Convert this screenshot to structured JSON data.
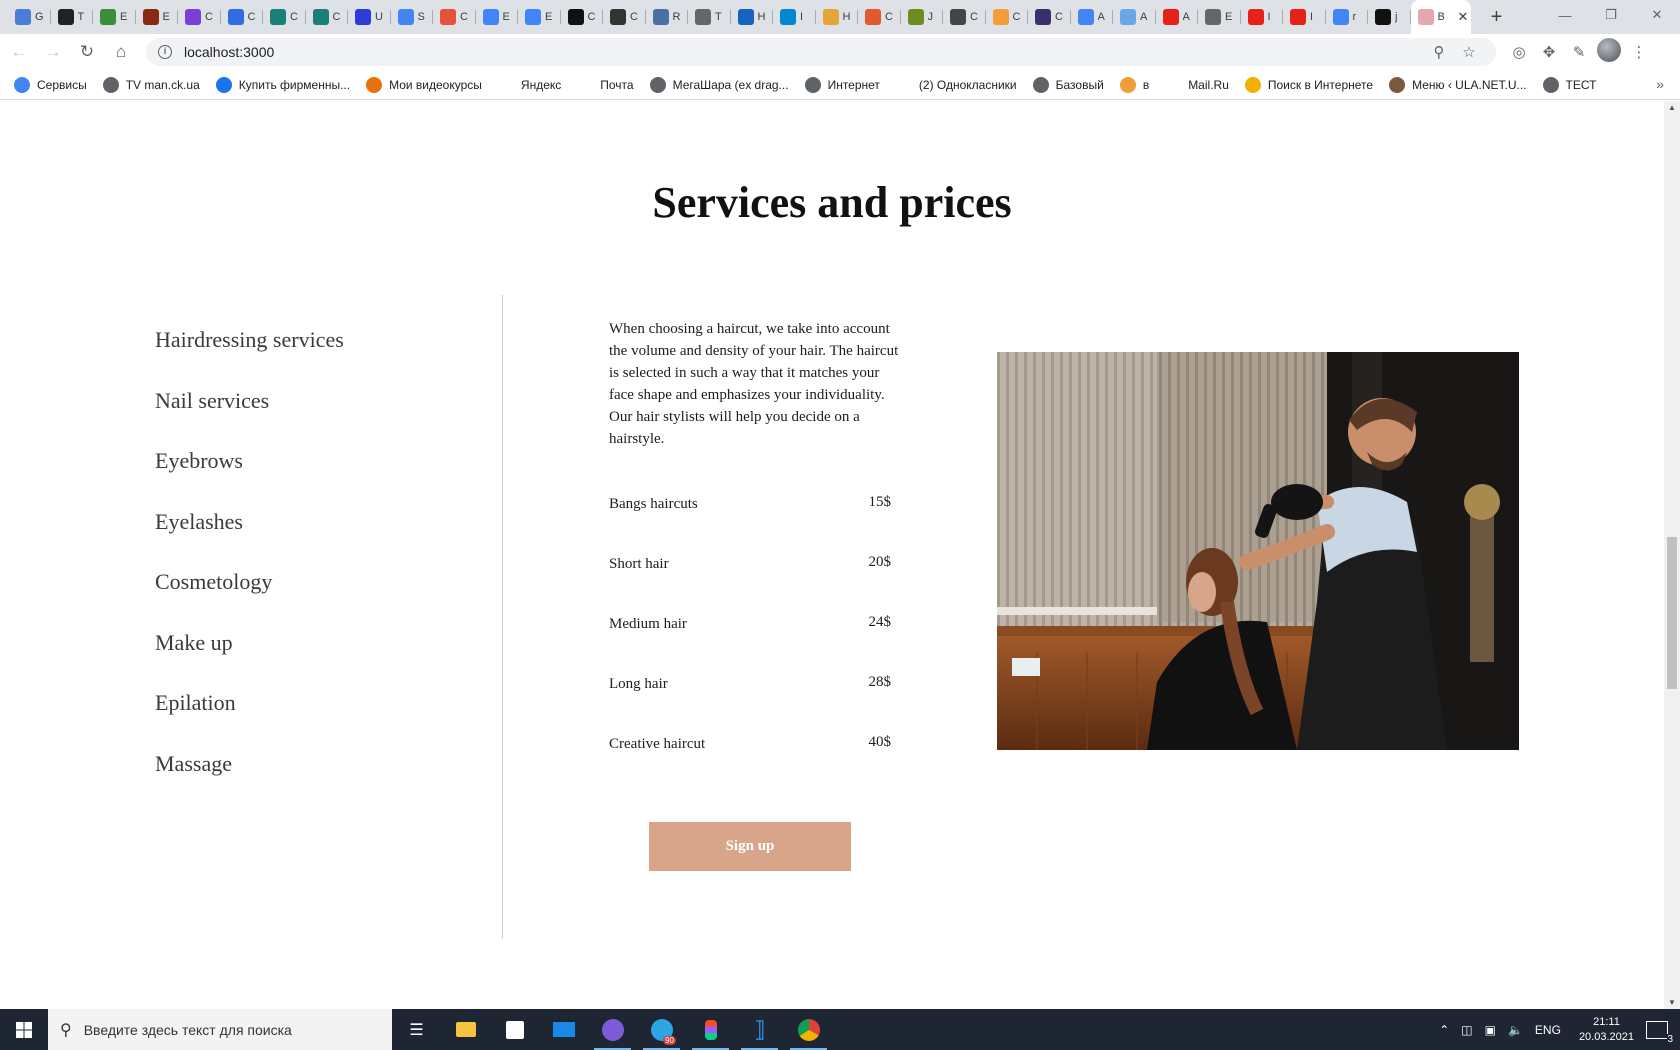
{
  "browser": {
    "tabs": [
      {
        "title": "G",
        "color": "#4a7dd6"
      },
      {
        "title": "T",
        "color": "#222222"
      },
      {
        "title": "E",
        "color": "#3a8f3a"
      },
      {
        "title": "E",
        "color": "#8b2a14"
      },
      {
        "title": "C",
        "color": "#7b3fd8"
      },
      {
        "title": "C",
        "color": "#2f6de1"
      },
      {
        "title": "C",
        "color": "#1a7f78"
      },
      {
        "title": "C",
        "color": "#1a7f78"
      },
      {
        "title": "U",
        "color": "#2f3bd6"
      },
      {
        "title": "S",
        "color": "#4285f4"
      },
      {
        "title": "C",
        "color": "#e5533d"
      },
      {
        "title": "E",
        "color": "#4285f4"
      },
      {
        "title": "E",
        "color": "#4285f4"
      },
      {
        "title": "C",
        "color": "#111111"
      },
      {
        "title": "C",
        "color": "#333333"
      },
      {
        "title": "R",
        "color": "#4a6fa5"
      },
      {
        "title": "T",
        "color": "#666666"
      },
      {
        "title": "H",
        "color": "#1565c0"
      },
      {
        "title": "I",
        "color": "#0288d1"
      },
      {
        "title": "H",
        "color": "#e8a33d"
      },
      {
        "title": "C",
        "color": "#e05a2b"
      },
      {
        "title": "J",
        "color": "#6b8e23"
      },
      {
        "title": "C",
        "color": "#444444"
      },
      {
        "title": "C",
        "color": "#f29d38"
      },
      {
        "title": "C",
        "color": "#3b2f6b"
      },
      {
        "title": "A",
        "color": "#4285f4"
      },
      {
        "title": "A",
        "color": "#6aa6e8"
      },
      {
        "title": "A",
        "color": "#e62117"
      },
      {
        "title": "E",
        "color": "#666666"
      },
      {
        "title": "I",
        "color": "#e62117"
      },
      {
        "title": "I",
        "color": "#e62117"
      },
      {
        "title": "r",
        "color": "#4285f4"
      },
      {
        "title": "j",
        "color": "#111111"
      }
    ],
    "active_tab": {
      "title": "B",
      "color": "#e7a7b0"
    },
    "url": "localhost:3000",
    "bookmarks": [
      {
        "label": "Сервисы",
        "color": "#4285f4"
      },
      {
        "label": "TV man.ck.ua",
        "color": "#5f6368"
      },
      {
        "label": "Купить фирменны...",
        "color": "#1a73e8"
      },
      {
        "label": "Мои видеокурсы",
        "color": "#e8710a"
      },
      {
        "label": "Яндекс",
        "color": "#ffffff"
      },
      {
        "label": "Почта",
        "color": "#ffffff"
      },
      {
        "label": "МегаШара (ex drag...",
        "color": "#5f6368"
      },
      {
        "label": "Интернет",
        "color": "#5f6368"
      },
      {
        "label": "(2) Однокласники",
        "color": "#ffffff"
      },
      {
        "label": "Базовый",
        "color": "#5f6368"
      },
      {
        "label": "в",
        "color": "#f29d38"
      },
      {
        "label": "Mail.Ru",
        "color": "#ffffff"
      },
      {
        "label": "Поиск в Интернете",
        "color": "#f2b100"
      },
      {
        "label": "Меню ‹ ULA.NET.U...",
        "color": "#7a5a3a"
      },
      {
        "label": "ТЕСТ",
        "color": "#5f6368"
      }
    ]
  },
  "page": {
    "heading": "Services and prices",
    "menu": [
      "Hairdressing services",
      "Nail services",
      "Eyebrows",
      "Eyelashes",
      "Cosmetology",
      "Make up",
      "Epilation",
      "Massage"
    ],
    "description": "When choosing a haircut, we take into account the volume and density of your hair. The haircut is selected in such a way that it matches your face shape and emphasizes your individuality. Our hair stylists will help you decide on a hairstyle.",
    "prices": [
      {
        "name": "Bangs haircuts",
        "price": "15$"
      },
      {
        "name": "Short hair",
        "price": "20$"
      },
      {
        "name": "Medium hair",
        "price": "24$"
      },
      {
        "name": "Long hair",
        "price": "28$"
      },
      {
        "name": "Creative haircut",
        "price": "40$"
      }
    ],
    "signup_label": "Sign up"
  },
  "taskbar": {
    "search_placeholder": "Введите здесь текст для поиска",
    "telegram_badge": "90",
    "language": "ENG",
    "time": "21:11",
    "date": "20.03.2021",
    "notifications": "3"
  }
}
